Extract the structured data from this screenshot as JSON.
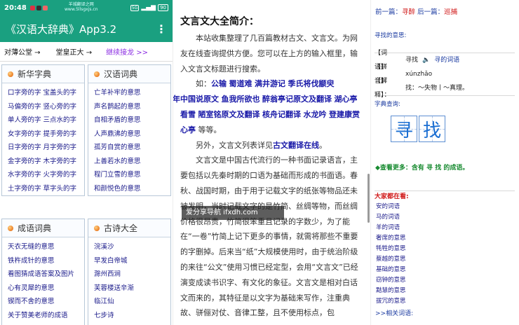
{
  "panel1": {
    "status": {
      "time": "20:48",
      "site_line1": "羊城翻译之网",
      "site_line2": "www.5llsgxjs.cn",
      "net": "5G",
      "battery": "90"
    },
    "app_title": "《汉语大辞典》App3.2",
    "menu_icon": "more-vert-icon",
    "nav": [
      {
        "label": "对薄公堂 →"
      },
      {
        "label": "堂皇正大 →"
      },
      {
        "label": "继续接龙 >>"
      }
    ],
    "boxes": [
      {
        "title": "新华字典",
        "items": [
          "口字旁的字 宝盖头的字",
          "马偏旁的字 竖心旁的字",
          "单人旁的字 三点水的字",
          "女字旁的字 提手旁的字",
          "日字旁的字 月字旁的字",
          "金字旁的字 木字旁的字",
          "水字旁的字 火字旁的字",
          "土字旁的字 草字头的字"
        ]
      },
      {
        "title": "汉语词典",
        "items": [
          "亡羊补牢的意思",
          "声名鹊起的意思",
          "自相矛盾的意思",
          "人声鼎沸的意思",
          "孤芳自赏的意思",
          "上善若水的意思",
          "程门立雪的意思",
          "和颜悦色的意思"
        ]
      },
      {
        "title": "成语词典",
        "items": [
          "天衣无缝的意思",
          "铁杵成针的意思",
          "看图猜成语答案及图片",
          "心有灵犀的意思",
          "锲而不舍的意思",
          "关于赞美老师的成语"
        ]
      },
      {
        "title": "古诗大全",
        "items": [
          "浣溪沙",
          "早发白帝城",
          "滁州西涧",
          "芙蓉楼送辛渐",
          "临江仙",
          "七步诗"
        ]
      }
    ]
  },
  "panel2": {
    "heading": "文言文大全简介：",
    "p1": "本站收集整理了几百篇教材古文、文言文。为网友在线查询提供方便。您可以在上方的输入框里，输入文言文标题进行搜索。",
    "p2_lead": "如：",
    "links": [
      "公输",
      "蜀道难",
      "满井游记",
      "季氏将伐颛臾",
      "少年中国说原文",
      "鱼我所欲也",
      "醉翁亭记原文及翻译",
      "湖心亭看雪",
      "陋室铭原文及翻译",
      "核舟记翻译",
      "水龙吟",
      "登建康赏心亭"
    ],
    "p2_tail": "等等。",
    "p3_lead": "另外，文言文列表详见",
    "p3_link": "古文翻译在线",
    "p3_tail": "。",
    "p4": "文言文是中国古代流行的一种书面记录语言，主要包括以先秦时期的口语为基础而形成的书面语。春秋、战国时期，由于用于记载文字的纸张等物品还未被发明，当时记载文字的是竹简、丝绸等物，而丝绸价格很昂贵，竹简很笨重且记录的字数少，为了能在“一卷”竹简上记下更多的事情，就需将那些不重要的字删掉。后来当“纸”大规模使用时，由于统治阶级的来往“公文”使用习惯已经定型，会用“文言文”已经演变成读书识字、有文化的象征。文言文是相对白话文而来的，其特征是以文字为基础来写作，注重典故、骈俪对仗、音律工整，且不使用标点，包",
    "watermark": "爱分享导航 ifxdh.com"
  },
  "panel3": {
    "prev_label": "前一篇：",
    "prev": "寻醉",
    "next_label": "后一篇：",
    "next": "巡捕",
    "meaning_label": "寻找的意思:",
    "defs": [
      {
        "k": "【词语】：",
        "v": "寻找",
        "extra": "寻的词语"
      },
      {
        "k": "【拼音】：",
        "v": "xúnzhǎo"
      },
      {
        "k": "【解释】：",
        "v": "找：～失物丨～真理。"
      }
    ],
    "dict_label": "字典查询:",
    "chars": [
      "寻",
      "找"
    ],
    "more": "查看更多：含有 寻 找 的成语。",
    "dajia_title": "大家都在看:",
    "dajia_items": [
      "安的词语",
      "马的词语",
      "羊的词语",
      "奢席的意思",
      "牦牲的意思",
      "蔡越的意思",
      "基础的意思",
      "窃钟的意思",
      "黠慧的意思",
      "拔冗的意思"
    ],
    "related": ">>相关词语:"
  }
}
